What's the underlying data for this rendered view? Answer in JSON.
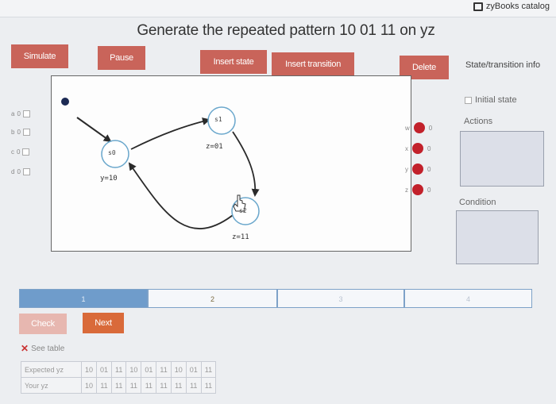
{
  "header": {
    "catalog_label": "zyBooks catalog",
    "title": "Generate the repeated pattern 10 01 11 on yz"
  },
  "toolbar": {
    "simulate": "Simulate",
    "pause": "Pause",
    "insert_state": "Insert state",
    "insert_transition": "Insert transition",
    "delete": "Delete"
  },
  "side_panel": {
    "title": "State/transition info",
    "initial_state": "Initial state",
    "actions": "Actions",
    "condition": "Condition"
  },
  "inputs": [
    {
      "name": "a",
      "value": "0"
    },
    {
      "name": "b",
      "value": "0"
    },
    {
      "name": "c",
      "value": "0"
    },
    {
      "name": "d",
      "value": "0"
    }
  ],
  "outputs": [
    {
      "name": "w",
      "value": "0"
    },
    {
      "name": "x",
      "value": "0"
    },
    {
      "name": "y",
      "value": "0"
    },
    {
      "name": "z",
      "value": "0"
    }
  ],
  "states": [
    {
      "id": "s0",
      "label": "s0",
      "action": "y=10"
    },
    {
      "id": "s1",
      "label": "s1",
      "action": "z=01"
    },
    {
      "id": "s2",
      "label": "s2",
      "action": "z=11"
    }
  ],
  "progress": {
    "segments": [
      "1",
      "2",
      "3",
      "4"
    ]
  },
  "buttons": {
    "check": "Check",
    "next": "Next"
  },
  "results": {
    "see_table": "See table",
    "rows": [
      {
        "label": "Expected yz",
        "cells": [
          "10",
          "01",
          "11",
          "10",
          "01",
          "11",
          "10",
          "01",
          "11"
        ]
      },
      {
        "label": "Your yz",
        "cells": [
          "10",
          "11",
          "11",
          "11",
          "11",
          "11",
          "11",
          "11",
          "11"
        ]
      }
    ]
  }
}
